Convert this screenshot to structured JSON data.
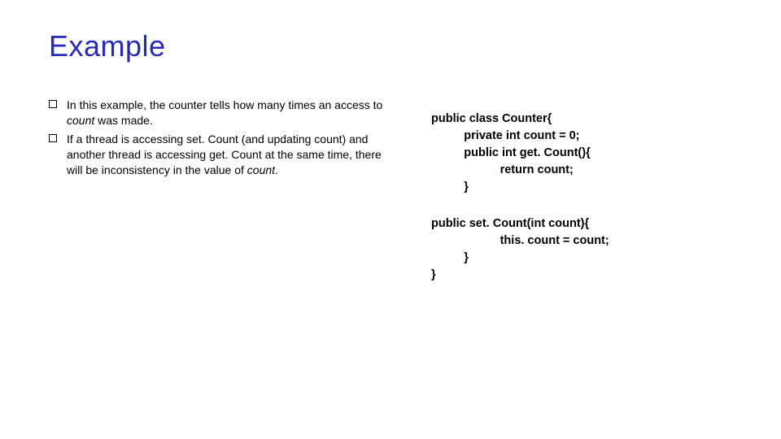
{
  "title": "Example",
  "bullets": [
    {
      "pre": "In this example, the counter tells how many times an access to ",
      "italic": "count",
      "post": " was made."
    },
    {
      "pre": "If a thread is accessing set. Count (and updating count) and another thread is accessing get. Count at the same time, there will be inconsistency in the value of ",
      "italic": "count",
      "post": "."
    }
  ],
  "code": {
    "l0": "public class Counter{",
    "l1": "          private int count = 0;",
    "l2": "          public int get. Count(){",
    "l3": "                     return count;",
    "l4": "          }",
    "l5": "public set. Count(int count){",
    "l6": "                     this. count = count;",
    "l7": "          }",
    "l8": "}"
  }
}
